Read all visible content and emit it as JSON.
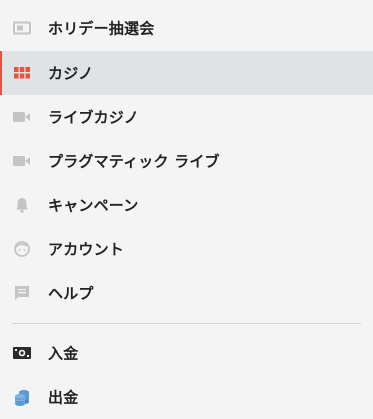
{
  "menu": {
    "items": [
      {
        "label": "ホリデー抽選会",
        "icon": "ticket-icon"
      },
      {
        "label": "カジノ",
        "icon": "casino-grid-icon",
        "active": true
      },
      {
        "label": "ライブカジノ",
        "icon": "video-camera-icon"
      },
      {
        "label": "プラグマティック ライブ",
        "icon": "video-camera-icon"
      },
      {
        "label": "キャンペーン",
        "icon": "bell-icon"
      },
      {
        "label": "アカウント",
        "icon": "account-face-icon"
      },
      {
        "label": "ヘルプ",
        "icon": "chat-icon"
      }
    ],
    "bottom_items": [
      {
        "label": "入金",
        "icon": "deposit-cash-icon"
      },
      {
        "label": "出金",
        "icon": "withdraw-coins-icon"
      }
    ]
  },
  "colors": {
    "background": "#f4f4f4",
    "active_background": "#dfe3e6",
    "accent": "#e8533c",
    "icon_gray": "#c4c4c4",
    "text": "#222222",
    "coin_blue": "#5b9bd5"
  }
}
